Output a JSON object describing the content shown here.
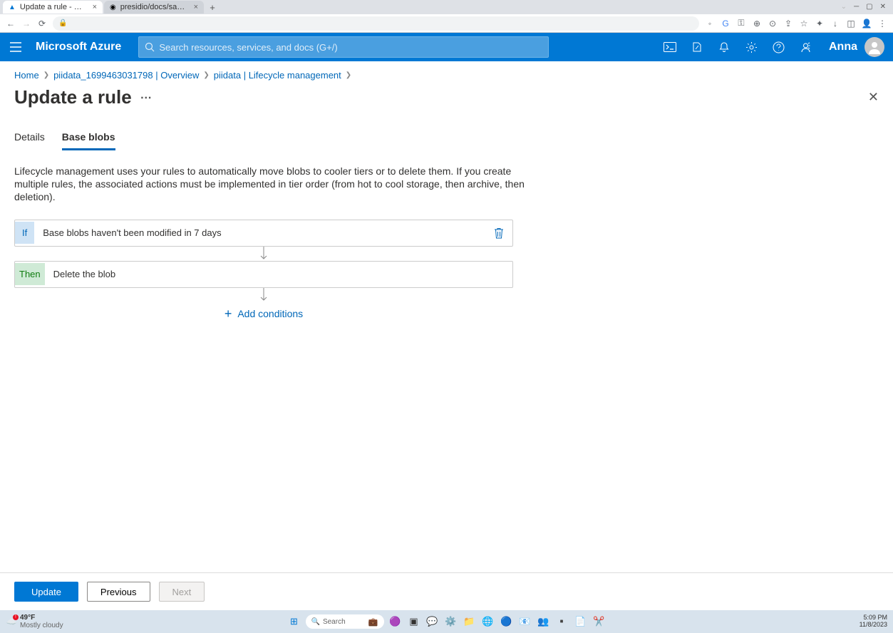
{
  "browser": {
    "tabs": [
      {
        "title": "Update a rule - Microsoft Azure",
        "active": true
      },
      {
        "title": "presidio/docs/samples/deploy",
        "active": false
      }
    ],
    "windowControls": {
      "min": "─",
      "max": "▢",
      "close": "✕"
    }
  },
  "azure": {
    "brand": "Microsoft Azure",
    "searchPlaceholder": "Search resources, services, and docs (G+/)",
    "user": "Anna"
  },
  "breadcrumb": {
    "items": [
      "Home",
      "piidata_1699463031798 | Overview",
      "piidata | Lifecycle management"
    ]
  },
  "page": {
    "title": "Update a rule",
    "tabs": [
      "Details",
      "Base blobs"
    ],
    "activeTab": "Base blobs",
    "description": "Lifecycle management uses your rules to automatically move blobs to cooler tiers or to delete them. If you create multiple rules, the associated actions must be implemented in tier order (from hot to cool storage, then archive, then deletion).",
    "ifLabel": "If",
    "ifText": "Base blobs haven't been modified in 7 days",
    "thenLabel": "Then",
    "thenText": "Delete the blob",
    "addConditions": "Add conditions"
  },
  "footer": {
    "update": "Update",
    "previous": "Previous",
    "next": "Next"
  },
  "taskbar": {
    "temp": "49°F",
    "weather": "Mostly cloudy",
    "searchPlaceholder": "Search",
    "time": "5:09 PM",
    "date": "11/8/2023"
  }
}
